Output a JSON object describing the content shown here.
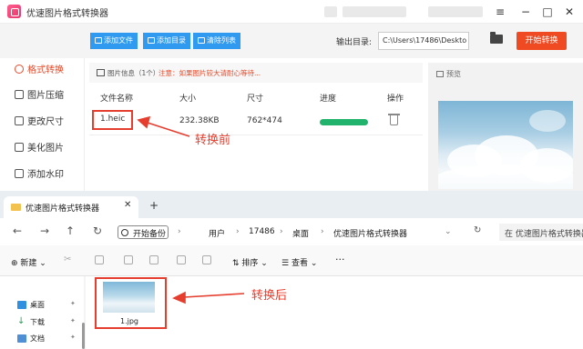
{
  "app": {
    "title": "优速图片格式转换器",
    "toolbar": {
      "add_file": "添加文件",
      "add_folder": "添加目录",
      "clear_list": "清除列表",
      "output_label": "输出目录:",
      "output_path": "C:\\Users\\17486\\Deskto",
      "start_button": "开始转换"
    },
    "sidebar": [
      {
        "label": "格式转换",
        "active": true
      },
      {
        "label": "图片压缩",
        "active": false
      },
      {
        "label": "更改尺寸",
        "active": false
      },
      {
        "label": "美化图片",
        "active": false
      },
      {
        "label": "添加水印",
        "active": false
      }
    ],
    "info": {
      "label": "图片信息（1个）",
      "note": "注意：如果图片较大请耐心等待..."
    },
    "table": {
      "headers": [
        "文件名称",
        "大小",
        "尺寸",
        "进度",
        "操作"
      ],
      "rows": [
        {
          "name": "1.heic",
          "size": "232.38KB",
          "dimensions": "762*474",
          "progress": 1.0
        }
      ]
    },
    "preview_label": "预览",
    "colors": {
      "accent": "#2f9af0",
      "start": "#f04a23",
      "active": "#e84a2a",
      "progress": "#21b36b"
    }
  },
  "explorer": {
    "tab_title": "优速图片格式转换器",
    "breadcrumb": [
      "开始备份",
      "用户",
      "17486",
      "桌面",
      "优速图片格式转换器"
    ],
    "search_placeholder": "在 优速图片格式转换器",
    "commands": {
      "new": "新建",
      "sort": "排序",
      "view": "查看"
    },
    "nav_items": [
      "桌面",
      "下载",
      "文档"
    ],
    "files": [
      {
        "name": "1.jpg"
      }
    ]
  },
  "annotations": {
    "before": "转换前",
    "after": "转换后",
    "color": "#e53d2e"
  }
}
